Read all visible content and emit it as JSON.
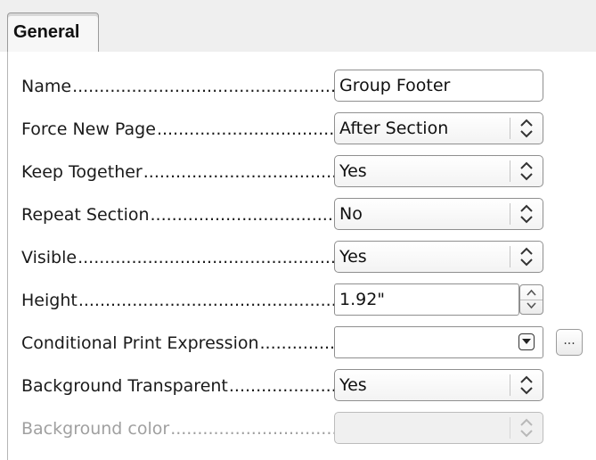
{
  "tabs": [
    {
      "label": "General",
      "active": true
    }
  ],
  "rows": [
    {
      "label": "Name",
      "control": "text",
      "value": "Group Footer"
    },
    {
      "label": "Force New Page",
      "control": "select",
      "value": "After Section"
    },
    {
      "label": "Keep Together",
      "control": "select",
      "value": "Yes"
    },
    {
      "label": "Repeat Section",
      "control": "select",
      "value": "No"
    },
    {
      "label": "Visible",
      "control": "select",
      "value": "Yes"
    },
    {
      "label": "Height",
      "control": "spinbox",
      "value": "1.92\""
    },
    {
      "label": "Conditional Print Expression",
      "control": "combo",
      "value": "",
      "button_label": "..."
    },
    {
      "label": "Background Transparent",
      "control": "select",
      "value": "Yes"
    },
    {
      "label": "Background color",
      "control": "select-disabled",
      "value": ""
    }
  ],
  "dot_leader": "......................................................................................................................",
  "colors": {
    "disabled_text": "#a0a0a0",
    "border": "#8f8f8f",
    "tabbar_bg": "#efefef"
  }
}
